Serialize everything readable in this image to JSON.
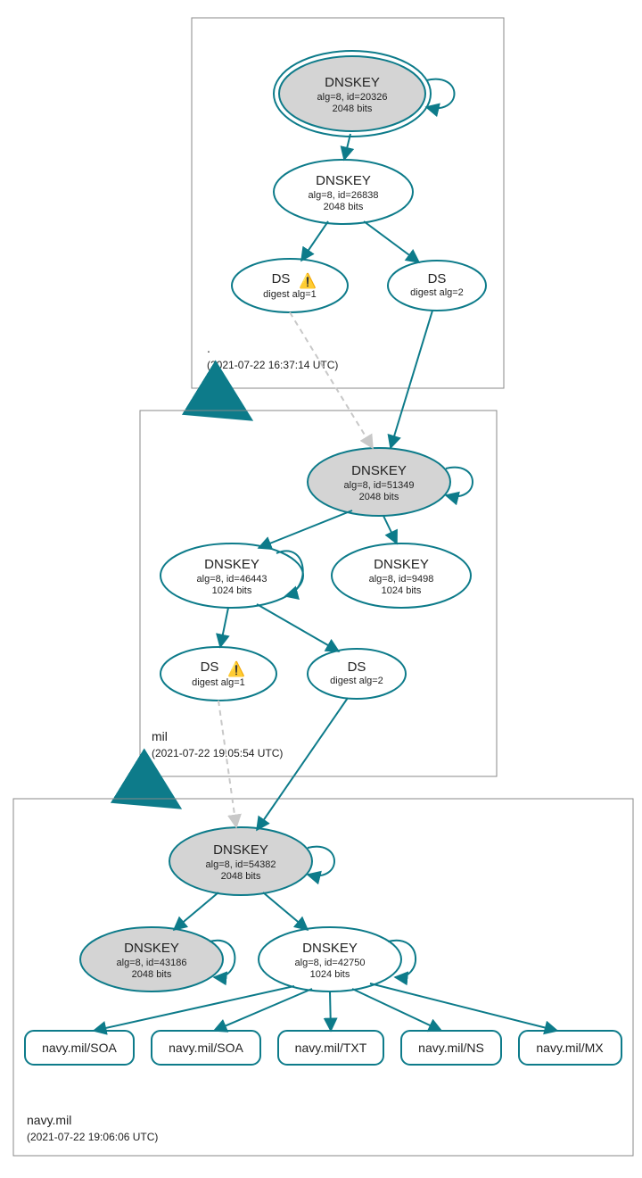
{
  "zones": {
    "root": {
      "label": ".",
      "time": "(2021-07-22 16:37:14 UTC)"
    },
    "mil": {
      "label": "mil",
      "time": "(2021-07-22 19:05:54 UTC)"
    },
    "navy": {
      "label": "navy.mil",
      "time": "(2021-07-22 19:06:06 UTC)"
    }
  },
  "nodes": {
    "root_ksk": {
      "title": "DNSKEY",
      "l1": "alg=8, id=20326",
      "l2": "2048 bits"
    },
    "root_zsk": {
      "title": "DNSKEY",
      "l1": "alg=8, id=26838",
      "l2": "2048 bits"
    },
    "root_ds1": {
      "title": "DS",
      "l1": "digest alg=1"
    },
    "root_ds2": {
      "title": "DS",
      "l1": "digest alg=2"
    },
    "mil_ksk": {
      "title": "DNSKEY",
      "l1": "alg=8, id=51349",
      "l2": "2048 bits"
    },
    "mil_zsk1": {
      "title": "DNSKEY",
      "l1": "alg=8, id=46443",
      "l2": "1024 bits"
    },
    "mil_zsk2": {
      "title": "DNSKEY",
      "l1": "alg=8, id=9498",
      "l2": "1024 bits"
    },
    "mil_ds1": {
      "title": "DS",
      "l1": "digest alg=1"
    },
    "mil_ds2": {
      "title": "DS",
      "l1": "digest alg=2"
    },
    "navy_ksk": {
      "title": "DNSKEY",
      "l1": "alg=8, id=54382",
      "l2": "2048 bits"
    },
    "navy_zsk1": {
      "title": "DNSKEY",
      "l1": "alg=8, id=43186",
      "l2": "2048 bits"
    },
    "navy_zsk2": {
      "title": "DNSKEY",
      "l1": "alg=8, id=42750",
      "l2": "1024 bits"
    },
    "rr1": {
      "title": "navy.mil/SOA"
    },
    "rr2": {
      "title": "navy.mil/SOA"
    },
    "rr3": {
      "title": "navy.mil/TXT"
    },
    "rr4": {
      "title": "navy.mil/NS"
    },
    "rr5": {
      "title": "navy.mil/MX"
    }
  },
  "warn_glyph": "⚠️"
}
